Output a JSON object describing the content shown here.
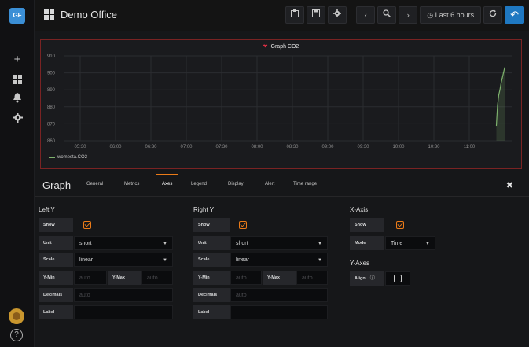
{
  "sidemenu": {
    "logo_text": "GF"
  },
  "navbar": {
    "title": "Demo Office",
    "time_range_label": "Last 6 hours"
  },
  "panel": {
    "title": "Graph CO2",
    "legend_series": "womesta.CO2"
  },
  "chart_data": {
    "type": "line",
    "title": "Graph CO2",
    "x_ticks": [
      "05:30",
      "06:00",
      "06:30",
      "07:00",
      "07:30",
      "08:00",
      "08:30",
      "09:00",
      "09:30",
      "10:00",
      "10:30",
      "11:00"
    ],
    "y_ticks": [
      "910",
      "900",
      "890",
      "880",
      "870",
      "860"
    ],
    "ylim": [
      860,
      910
    ],
    "series": [
      {
        "name": "womesta.CO2",
        "color": "#7eb26d",
        "x": [
          "11:23",
          "11:24",
          "11:25",
          "11:26",
          "11:27",
          "11:28",
          "11:29",
          "11:30"
        ],
        "values": [
          869,
          881,
          887,
          890,
          894,
          897,
          900,
          903
        ]
      }
    ],
    "grid": true,
    "legend_position": "bottom-left"
  },
  "editor": {
    "title": "Graph",
    "tabs": [
      "General",
      "Metrics",
      "Axes",
      "Legend",
      "Display",
      "Alert",
      "Time range"
    ],
    "active_tab": "Axes",
    "left_y": {
      "title": "Left Y",
      "show_label": "Show",
      "unit_label": "Unit",
      "unit_value": "short",
      "scale_label": "Scale",
      "scale_value": "linear",
      "ymin_label": "Y-Min",
      "ymin_placeholder": "auto",
      "ymax_label": "Y-Max",
      "ymax_placeholder": "auto",
      "decimals_label": "Decimals",
      "decimals_placeholder": "auto",
      "label_label": "Label"
    },
    "right_y": {
      "title": "Right Y",
      "show_label": "Show",
      "unit_label": "Unit",
      "unit_value": "short",
      "scale_label": "Scale",
      "scale_value": "linear",
      "ymin_label": "Y-Min",
      "ymin_placeholder": "auto",
      "ymax_label": "Y-Max",
      "ymax_placeholder": "auto",
      "decimals_label": "Decimals",
      "decimals_placeholder": "auto",
      "label_label": "Label"
    },
    "x_axis": {
      "title": "X-Axis",
      "show_label": "Show",
      "mode_label": "Mode",
      "mode_value": "Time"
    },
    "y_axes": {
      "title": "Y-Axes",
      "align_label": "Align"
    }
  }
}
